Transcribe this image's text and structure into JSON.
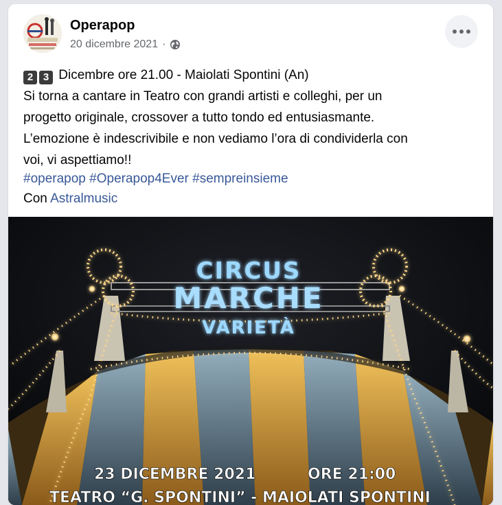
{
  "post": {
    "page_name": "Operapop",
    "date": "20 dicembre 2021",
    "separator": "·",
    "keycaps": [
      "2",
      "3"
    ],
    "line1_rest": "Dicembre ore 21.00 - Maiolati Spontini (An)",
    "line2": "Si torna a cantare in Teatro con grandi artisti e colleghi, per un",
    "line3": "progetto originale, crossover a tutto tondo ed entusiasmante.",
    "line4": "L’emozione è indescrivibile e non vediamo l’ora di condividerla con",
    "line5": "voi, vi aspettiamo!!",
    "hashtags": [
      "#operapop",
      "#Operapop4Ever",
      "#sempreinsieme"
    ],
    "with_label": "Con",
    "with_name": "Astralmusic"
  },
  "poster": {
    "circus": "CIRCUS",
    "marche": "MARCHE",
    "varieta": "VARIETÀ",
    "date_line": "23 DICEMBRE 2021",
    "time_line": "ORE 21:00",
    "venue_line": "TEATRO “G. SPONTINI” - MAIOLATI SPONTINI"
  },
  "colors": {
    "link": "#385898",
    "meta": "#65676b",
    "neon": "#8fd3ff",
    "bulb": "#ffd98a",
    "tent_yellow": "#e2a93a",
    "tent_blue": "#6f8fa3"
  },
  "icons": [
    "globe-icon",
    "more-options-icon"
  ]
}
